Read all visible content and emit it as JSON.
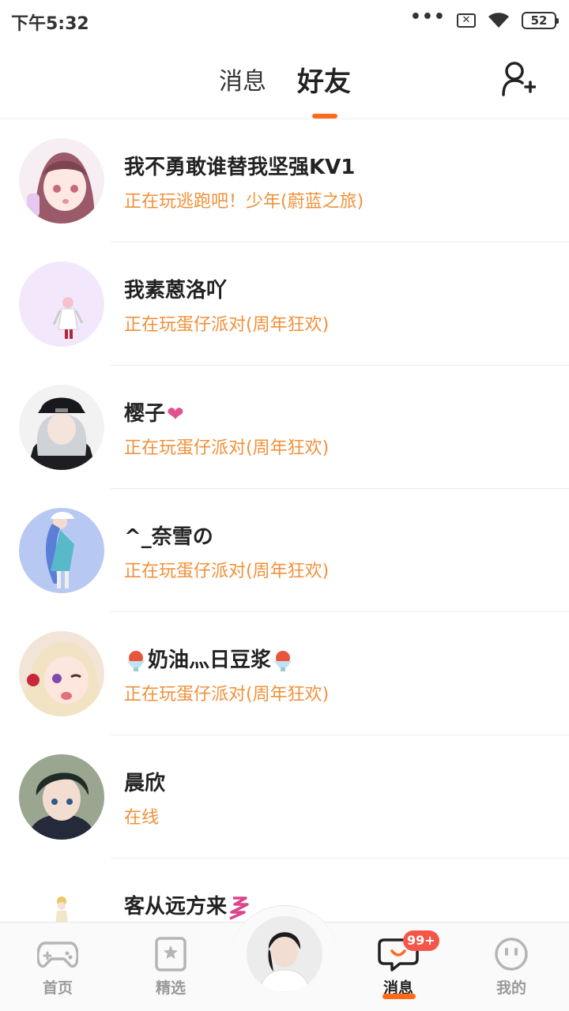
{
  "status_bar": {
    "time": "下午5:32",
    "dots": "•••",
    "sim_icon": "sim-x-icon",
    "wifi_icon": "wifi-icon",
    "battery": "52"
  },
  "header": {
    "tabs": [
      {
        "label": "消息",
        "active": false
      },
      {
        "label": "好友",
        "active": true
      }
    ],
    "add_friend_icon": "add-friend-icon",
    "accent_color": "#ff6a1a"
  },
  "friends": [
    {
      "name": "我不勇敢谁替我坚强KV1",
      "status": "正在玩逃跑吧！少年(蔚蓝之旅)"
    },
    {
      "name": "我素蒽洛吖",
      "status": "正在玩蛋仔派对(周年狂欢)"
    },
    {
      "name": "樱子",
      "name_emoji": "❤",
      "status": "正在玩蛋仔派对(周年狂欢)"
    },
    {
      "name": "^_奈雪の",
      "status": "正在玩蛋仔派对(周年狂欢)"
    },
    {
      "name": "奶油灬日豆浆",
      "status": "正在玩蛋仔派对(周年狂欢)"
    },
    {
      "name": "晨欣",
      "status": "在线"
    },
    {
      "name": "客从远方来",
      "status": ""
    }
  ],
  "status_color": "#f0913a",
  "bottom_nav": {
    "home": "首页",
    "featured": "精选",
    "messages": "消息",
    "mine": "我的",
    "badge": "99+"
  }
}
